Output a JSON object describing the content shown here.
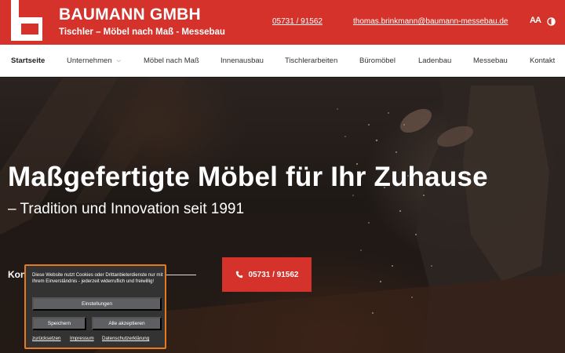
{
  "header": {
    "brand_name": "BAUMANN GMBH",
    "brand_tagline": "Tischler – Möbel nach Maß - Messebau",
    "phone": "05731 / 91562",
    "email": "thomas.brinkmann@baumann-messebau.de",
    "font_size_icon": "font-size-icon",
    "contrast_icon": "contrast-icon",
    "font_size_glyph": "AA",
    "accent_color": "#d4322a"
  },
  "nav": {
    "items": [
      {
        "label": "Startseite",
        "active": true
      },
      {
        "label": "Unternehmen",
        "has_dropdown": true
      },
      {
        "label": "Möbel nach Maß"
      },
      {
        "label": "Innenausbau"
      },
      {
        "label": "Tischlerarbeiten"
      },
      {
        "label": "Büromöbel"
      },
      {
        "label": "Ladenbau"
      },
      {
        "label": "Messebau"
      },
      {
        "label": "Kontakt"
      }
    ],
    "dropdown_icon": "chevron-down-icon"
  },
  "hero": {
    "title": "Maßgefertigte Möbel für Ihr Zuhause",
    "subtitle": "– Tradition und Innovation seit 1991",
    "contact_label": "Kontakt",
    "cta_label": "05731 / 91562",
    "cta_icon": "phone-icon"
  },
  "cookie": {
    "text": "Diese Website nutzt Cookies oder Drittanbieterdienste nur mit Ihrem Einverständnis - jederzeit widerruflich und freiwillig!",
    "settings_label": "Einstellungen",
    "save_label": "Speichern",
    "accept_label": "Alle akzeptieren",
    "reset_link": "zurücksetzen",
    "imprint_link": "Impressum",
    "privacy_link": "Datenschutzerklärung",
    "border_color": "#e57a1f"
  }
}
